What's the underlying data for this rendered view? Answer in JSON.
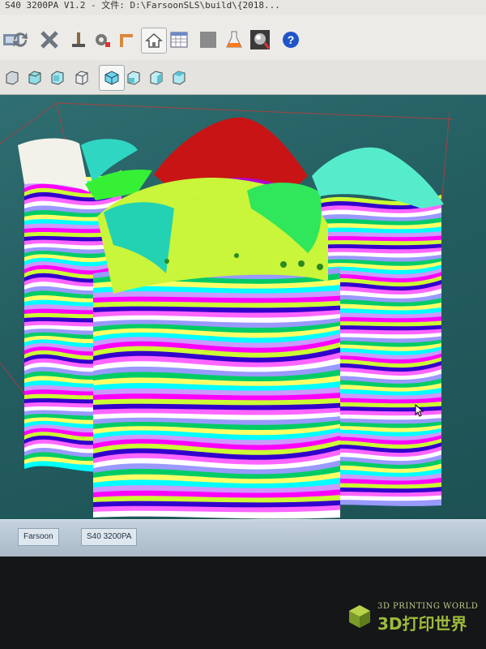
{
  "window": {
    "title": "S40 3200PA V1.2 - 文件: D:\\FarsoonSLS\\build\\{2018..."
  },
  "toolbar": {
    "row1_buttons": [
      {
        "icon": "layers-icon"
      },
      {
        "icon": "refresh-icon"
      },
      {
        "icon": "cross-icon"
      },
      {
        "icon": "tool-icon"
      },
      {
        "icon": "gear-icon"
      },
      {
        "icon": "corner-icon"
      },
      {
        "icon": "home-icon"
      },
      {
        "icon": "calendar-icon"
      },
      {
        "icon": "stop-icon"
      },
      {
        "icon": "flask-icon"
      },
      {
        "icon": "sphere-icon"
      },
      {
        "icon": "help-icon",
        "label": "?"
      }
    ],
    "row2_buttons": [
      {
        "icon": "view-cube-1-icon"
      },
      {
        "icon": "view-cube-2-icon"
      },
      {
        "icon": "view-cube-3-icon"
      },
      {
        "icon": "view-cube-4-icon"
      },
      {
        "icon": "view-cube-5-icon"
      },
      {
        "icon": "view-cube-6-icon"
      },
      {
        "icon": "view-cube-7-icon"
      },
      {
        "icon": "view-cube-8-icon"
      }
    ]
  },
  "viewport": {
    "background": "#2a6466",
    "layer_colors": [
      "#ff00ff",
      "#ffff66",
      "#ffffff",
      "#ccff33",
      "#00ffff",
      "#9999ff",
      "#3300cc",
      "#cc99ff",
      "#00cc66",
      "#ff66ff"
    ],
    "top_colors": {
      "red": "#cc1111",
      "green": "#33ff33",
      "cyan": "#33ddbb",
      "lime": "#ccff33"
    }
  },
  "taskbar": {
    "items": [
      "Farsoon",
      "S40 3200PA"
    ]
  },
  "watermark": {
    "en": "3D PRINTING WORLD",
    "cn": "3D打印世界"
  }
}
